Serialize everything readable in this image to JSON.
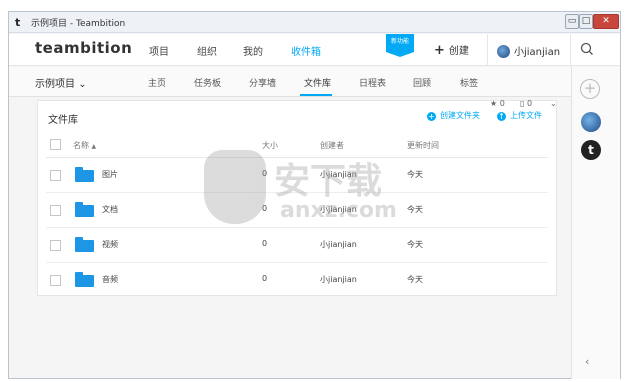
{
  "window": {
    "title": "示例项目 - Teambition",
    "app_icon": "t",
    "controls": {
      "minimize": "▭",
      "maximize": "□",
      "close": "✕"
    }
  },
  "header": {
    "logo": "teambition",
    "nav": [
      "项目",
      "组织",
      "我的",
      "收件箱"
    ],
    "active_nav": "收件箱",
    "new_badge": "新功能",
    "create_label": "创建",
    "create_icon": "+",
    "user_name": "小jianjian",
    "icons": [
      "avatar-globe",
      "search-icon"
    ]
  },
  "subnav": {
    "project_name": "示例项目",
    "project_chevron": "⌄",
    "tabs": [
      "主页",
      "任务板",
      "分享墙",
      "文件库",
      "日程表",
      "回顾",
      "标签"
    ],
    "active_tab": "文件库"
  },
  "file_library": {
    "title": "文件库",
    "star_count": "0",
    "clip_count": "0",
    "actions": {
      "create_folder": "创建文件夹",
      "upload_file": "上传文件"
    },
    "columns": {
      "name": "名称",
      "sort_indicator": "▲",
      "size": "大小",
      "creator": "创建者",
      "updated": "更新时间"
    },
    "rows": [
      {
        "name": "图片",
        "size": "0",
        "creator": "小jianjian",
        "updated": "今天"
      },
      {
        "name": "文档",
        "size": "0",
        "creator": "小jianjian",
        "updated": "今天"
      },
      {
        "name": "视频",
        "size": "0",
        "creator": "小jianjian",
        "updated": "今天"
      },
      {
        "name": "音频",
        "size": "0",
        "creator": "小jianjian",
        "updated": "今天"
      }
    ]
  },
  "right_sidebar": {
    "add_icon": "+",
    "app_icon_letter": "t",
    "collapse_icon": "‹"
  },
  "watermark": {
    "text": "安下载",
    "sub": "anxz.com"
  },
  "colors": {
    "accent": "#03a9f4",
    "folder": "#1e96e6",
    "close": "#c9463d"
  }
}
